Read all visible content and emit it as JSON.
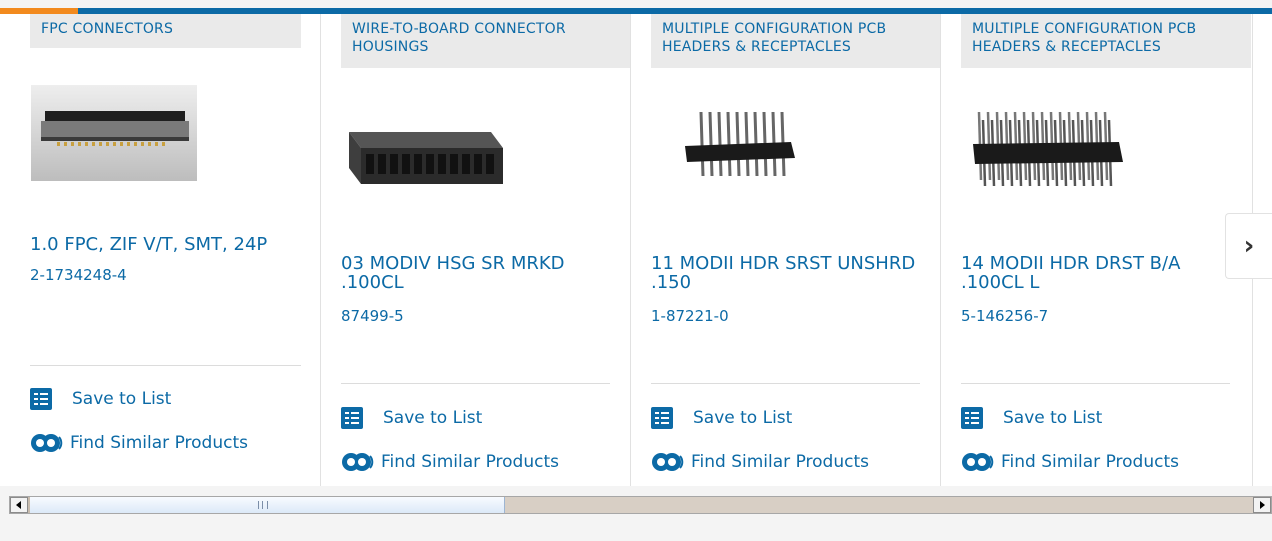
{
  "colors": {
    "accent_blue": "#0c6aa6",
    "accent_orange": "#f28a1e",
    "category_bg": "#eaeaea"
  },
  "products": [
    {
      "category": "FPC CONNECTORS",
      "name": "1.0 FPC, ZIF V/T, SMT, 24P",
      "part_number": "2-1734248-4",
      "image_icon": "fpc-connector-image",
      "save_label": "Save to List",
      "similar_label": "Find Similar Products"
    },
    {
      "category": "WIRE-TO-BOARD CONNECTOR HOUSINGS",
      "name": "03 MODIV HSG SR MRKD .100CL",
      "part_number": "87499-5",
      "image_icon": "connector-housing-image",
      "save_label": "Save to List",
      "similar_label": "Find Similar Products"
    },
    {
      "category": "MULTIPLE CONFIGURATION PCB HEADERS & RECEPTACLES",
      "name": "11 MODII HDR SRST UNSHRD .150",
      "part_number": "1-87221-0",
      "image_icon": "pcb-header-single-row-image",
      "save_label": "Save to List",
      "similar_label": "Find Similar Products"
    },
    {
      "category": "MULTIPLE CONFIGURATION PCB HEADERS & RECEPTACLES",
      "name": "14 MODII HDR DRST B/A .100CL L",
      "part_number": "5-146256-7",
      "image_icon": "pcb-header-dual-row-image",
      "save_label": "Save to List",
      "similar_label": "Find Similar Products"
    }
  ],
  "carousel": {
    "next_icon": "chevron-right-icon",
    "next_glyph": "›"
  },
  "scrollbar": {
    "left_icon": "scroll-left-arrow-icon",
    "right_icon": "scroll-right-arrow-icon"
  }
}
